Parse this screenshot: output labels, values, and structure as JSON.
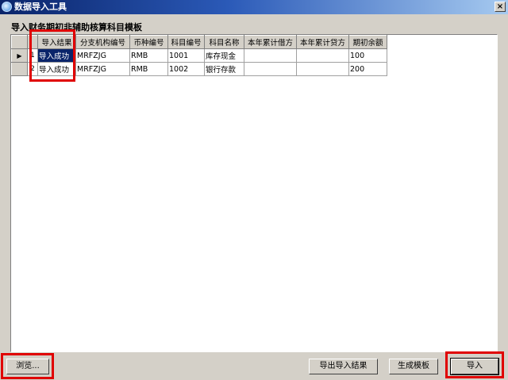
{
  "window": {
    "title": "数据导入工具",
    "close_label": "×"
  },
  "heading": "导入财务期初非辅助核算科目模板",
  "grid": {
    "columns": [
      "导入结果",
      "分支机构编号",
      "币种编号",
      "科目编号",
      "科目名称",
      "本年累计借方",
      "本年累计贷方",
      "期初余额"
    ],
    "rows": [
      {
        "num": "1",
        "marker": "▶",
        "cells": [
          "导入成功",
          "MRFZJG",
          "RMB",
          "1001",
          "库存现金",
          "",
          "",
          "100"
        ]
      },
      {
        "num": "2",
        "marker": "",
        "cells": [
          "导入成功",
          "MRFZJG",
          "RMB",
          "1002",
          "银行存款",
          "",
          "",
          "200"
        ]
      }
    ]
  },
  "buttons": {
    "browse": "浏览...",
    "export_result": "导出导入结果",
    "generate_template": "生成模板",
    "import": "导入"
  },
  "colors": {
    "highlight": "#e00000",
    "selection": "#0a246a"
  }
}
